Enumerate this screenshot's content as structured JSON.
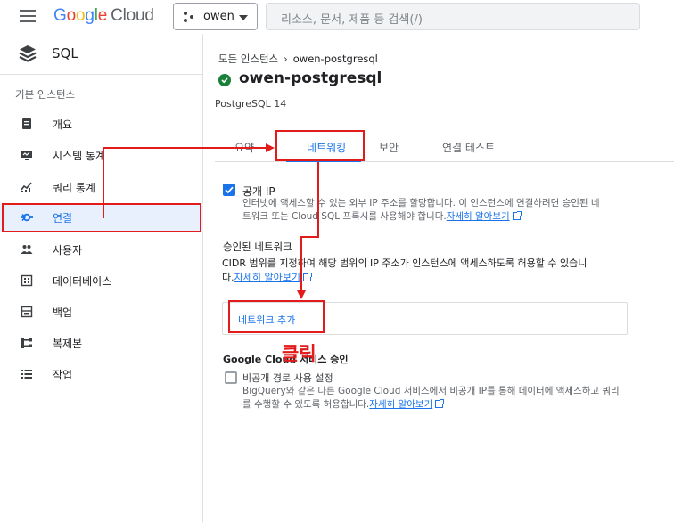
{
  "topbar": {
    "logo_google": [
      "G",
      "o",
      "o",
      "g",
      "l",
      "e"
    ],
    "logo_cloud": "Cloud",
    "project": "owen",
    "search_placeholder": "리소스, 문서, 제품 등 검색(/)"
  },
  "sidebar": {
    "title": "SQL",
    "section": "기본 인스턴스",
    "items": [
      {
        "label": "개요",
        "icon": "overview-icon"
      },
      {
        "label": "시스템 통계",
        "icon": "system-stats-icon"
      },
      {
        "label": "쿼리 통계",
        "icon": "query-stats-icon"
      },
      {
        "label": "연결",
        "icon": "connections-icon",
        "active": true
      },
      {
        "label": "사용자",
        "icon": "users-icon"
      },
      {
        "label": "데이터베이스",
        "icon": "database-icon"
      },
      {
        "label": "백업",
        "icon": "backup-icon"
      },
      {
        "label": "복제본",
        "icon": "replica-icon"
      },
      {
        "label": "작업",
        "icon": "operations-icon"
      }
    ]
  },
  "main": {
    "breadcrumb": {
      "root": "모든 인스턴스",
      "current": "owen-postgresql"
    },
    "instance_title": "owen-postgresql",
    "version": "PostgreSQL 14",
    "tabs": [
      {
        "label": "요약"
      },
      {
        "label": "네트워킹",
        "active": true
      },
      {
        "label": "보안"
      },
      {
        "label": "연결 테스트"
      }
    ],
    "public_ip": {
      "label": "공개 IP",
      "checked": true,
      "desc_line1": "인터넷에 액세스할 수 있는 외부 IP 주소를 할당합니다. 이 인스턴스에 연결하려면 승인된 네",
      "desc_line2": "트워크 또는 Cloud SQL 프록시를 사용해야 합니다.",
      "link": "자세히 알아보기"
    },
    "authorized": {
      "heading": "승인된 네트워크",
      "line1": "CIDR 범위를 지정하여 해당 범위의 IP 주소가 인스턴스에 액세스하도록 허용할 수 있습니",
      "line2": "다.",
      "link": "자세히 알아보기",
      "add_button": "네트워크 추가"
    },
    "gc_services": {
      "heading": "Google Cloud 서비스 승인",
      "label": "비공개 경로 사용 설정",
      "checked": false,
      "desc_line1": "BigQuery와 같은 다른 Google Cloud 서비스에서 비공개 IP를 통해 데이터에 액세스하고 쿼리",
      "desc_line2": "를 수행할 수 있도록 허용합니다.",
      "link": "자세히 알아보기"
    }
  },
  "annotation": {
    "click_text": "클릭",
    "color": "#e21b1b"
  },
  "colors": {
    "accent": "#1a73e8",
    "success": "#188038",
    "annotation": "#e21b1b"
  }
}
